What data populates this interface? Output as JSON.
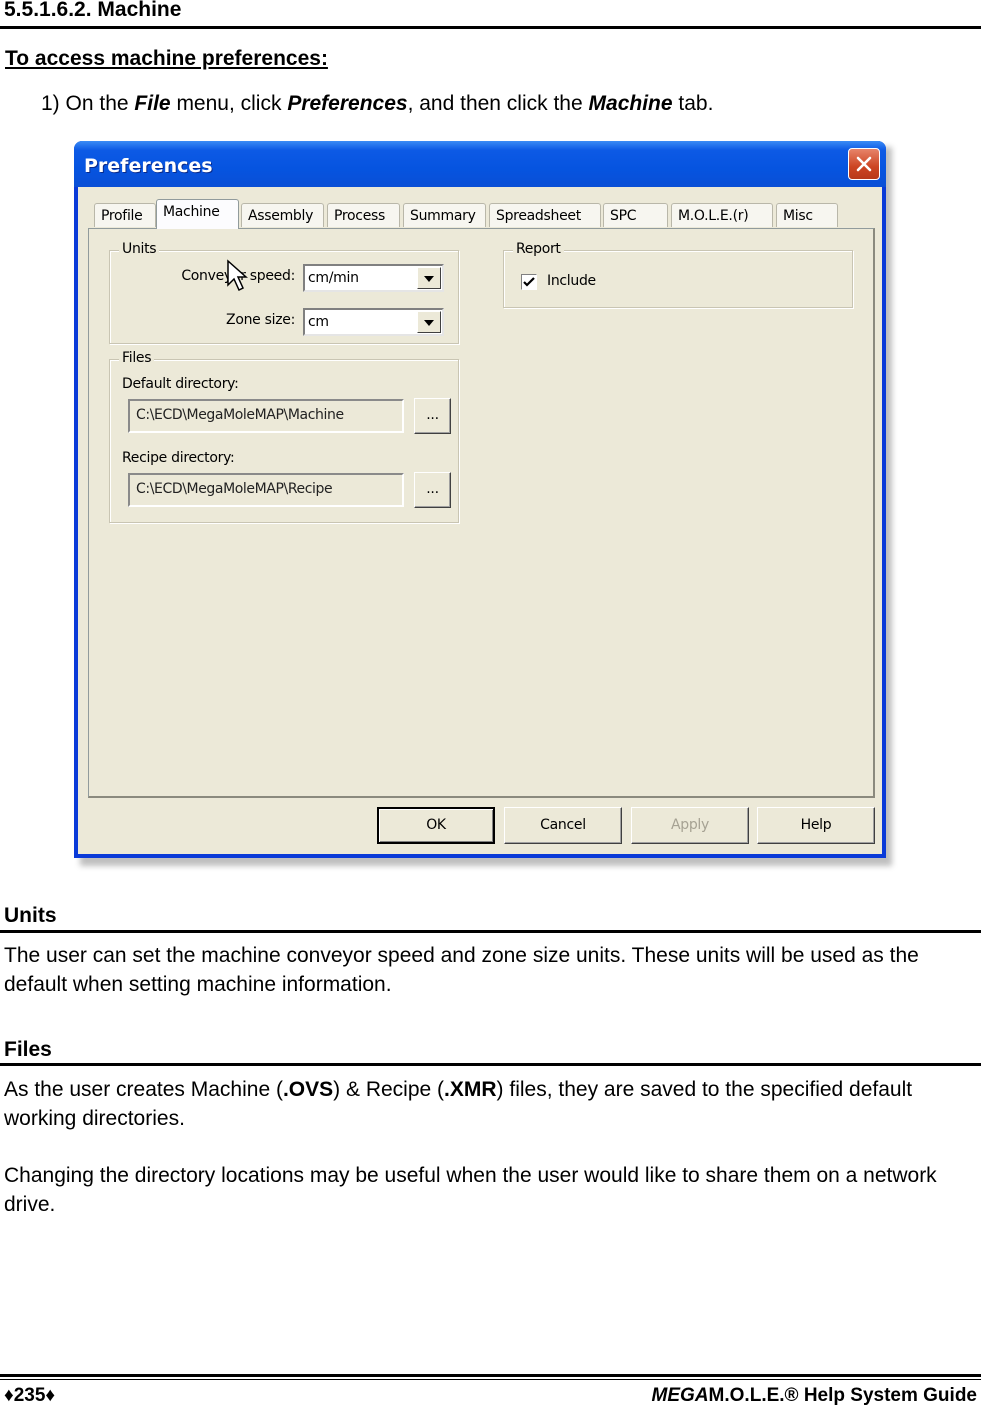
{
  "document": {
    "section_title": "5.5.1.6.2. Machine",
    "subheading": "To access machine preferences:",
    "step": {
      "number": "1)",
      "parts": [
        "On the ",
        "File",
        " menu, click ",
        "Preferences",
        ", and then click the ",
        "Machine",
        " tab."
      ]
    },
    "units_section": {
      "heading": "Units",
      "text": "The user can set the machine conveyor speed and zone size units. These units will be used as the default when setting machine information."
    },
    "files_section": {
      "heading": "Files",
      "para1_parts": [
        "As the user creates Machine (",
        ".OVS",
        ") & Recipe (",
        ".XMR",
        ") files, they are saved to the specified default working directories."
      ],
      "para2": "Changing the directory locations may be useful when the user would like to share them on a network drive."
    },
    "footer": {
      "page_number": "♦235♦",
      "guide_title_italic": "MEGA",
      "guide_title_rest": "M.O.L.E.® Help System Guide"
    }
  },
  "dialog": {
    "title": "Preferences",
    "close_icon": "close-x-icon",
    "tabs": [
      {
        "label": "Profile",
        "active": false
      },
      {
        "label": "Machine",
        "active": true
      },
      {
        "label": "Assembly",
        "active": false
      },
      {
        "label": "Process",
        "active": false
      },
      {
        "label": "Summary",
        "active": false
      },
      {
        "label": "Spreadsheet",
        "active": false
      },
      {
        "label": "SPC",
        "active": false
      },
      {
        "label": "M.O.L.E.(r)",
        "active": false
      },
      {
        "label": "Misc",
        "active": false
      }
    ],
    "units_group": {
      "label": "Units",
      "conveyor_speed_label": "Conveyor speed:",
      "conveyor_speed_value": "cm/min",
      "zone_size_label": "Zone size:",
      "zone_size_value": "cm"
    },
    "files_group": {
      "label": "Files",
      "default_dir_label": "Default directory:",
      "default_dir_value": "C:\\ECD\\MegaMoleMAP\\Machine",
      "recipe_dir_label": "Recipe directory:",
      "recipe_dir_value": "C:\\ECD\\MegaMoleMAP\\Recipe",
      "browse_label": "..."
    },
    "report_group": {
      "label": "Report",
      "include_label": "Include",
      "include_checked": true
    },
    "buttons": {
      "ok": "OK",
      "cancel": "Cancel",
      "apply": "Apply",
      "help": "Help"
    }
  }
}
